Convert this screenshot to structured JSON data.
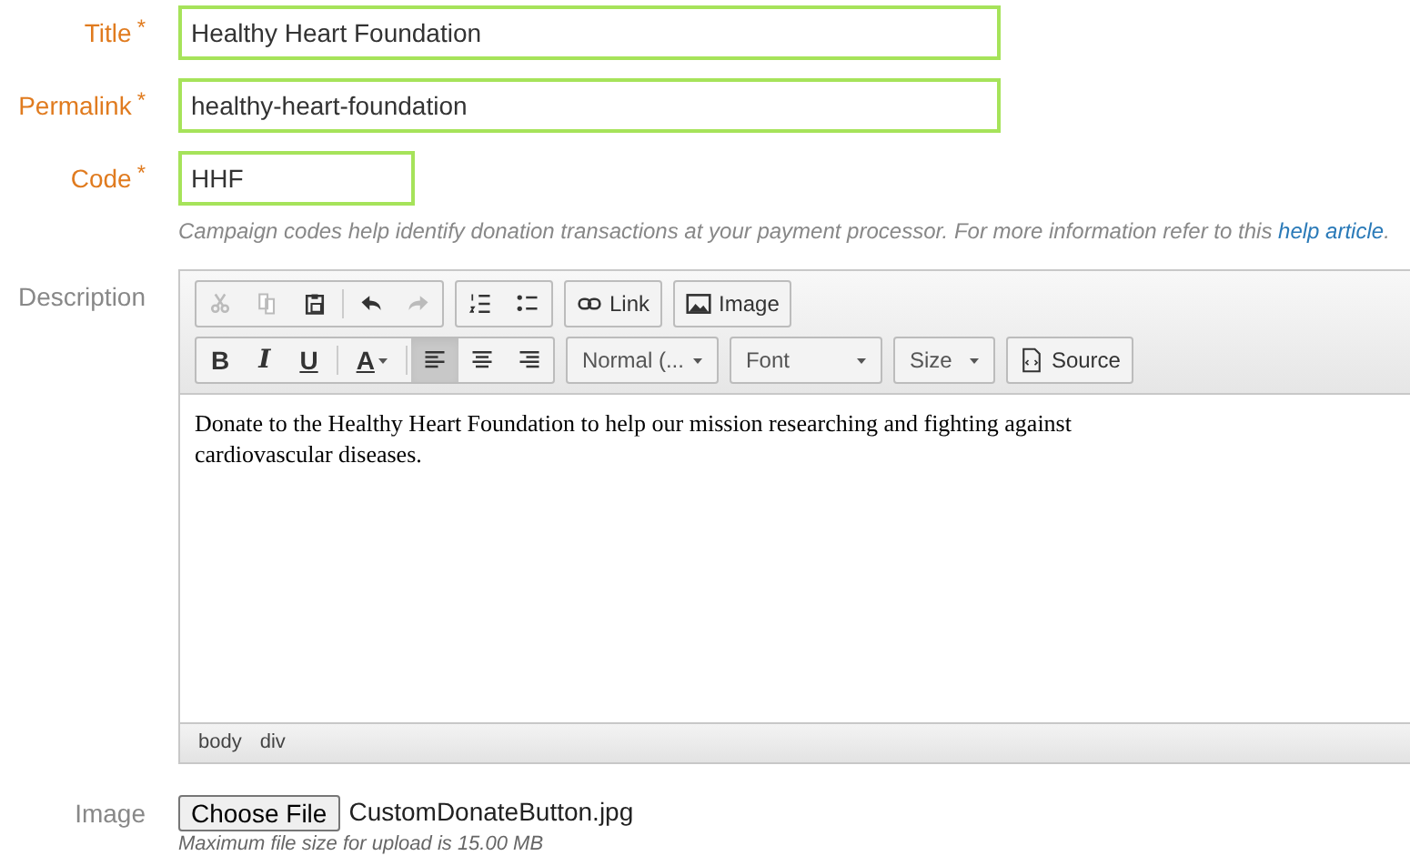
{
  "fields": [
    {
      "label": "Title",
      "marker": "*",
      "value": "Healthy Heart Foundation"
    },
    {
      "label": "Permalink",
      "marker": "*",
      "value": "healthy-heart-foundation"
    },
    {
      "label": "Code",
      "marker": "*",
      "value": "HHF"
    }
  ],
  "code_help": {
    "text": "Campaign codes help identify donation transactions at your payment processor. For more information refer to this",
    "link": "help article",
    "end": "."
  },
  "description": {
    "label": "Description",
    "toolbar_rows": [
      [
        {
          "items": [
            {
              "kind": "icon",
              "disabled": true
            },
            {
              "kind": "icon",
              "disabled": true
            },
            {
              "kind": "icon",
              "disabled": false
            },
            {
              "kind": "separator"
            },
            {
              "kind": "icon",
              "disabled": false
            },
            {
              "kind": "icon",
              "disabled": true
            }
          ]
        },
        {
          "items": [
            {
              "kind": "icon",
              "disabled": false
            },
            {
              "kind": "icon",
              "disabled": false
            }
          ]
        },
        {
          "items": [
            {
              "kind": "icon_text",
              "label": "Link"
            }
          ]
        },
        {
          "items": [
            {
              "kind": "icon_text",
              "label": "Image"
            }
          ]
        }
      ],
      [
        {
          "items": [
            {
              "kind": "char",
              "label": "B"
            },
            {
              "kind": "char",
              "label": "I"
            },
            {
              "kind": "char",
              "label": "U"
            },
            {
              "kind": "separator"
            },
            {
              "kind": "char",
              "label": "A"
            },
            {
              "kind": "separator"
            },
            {
              "kind": "icon",
              "selected": true
            },
            {
              "kind": "icon",
              "selected": false
            },
            {
              "kind": "icon",
              "selected": false
            }
          ]
        },
        {
          "items": [
            {
              "kind": "combo",
              "label": "Normal (..."
            }
          ]
        },
        {
          "items": [
            {
              "kind": "combo",
              "label": "Font"
            }
          ]
        },
        {
          "items": [
            {
              "kind": "combo",
              "label": "Size"
            }
          ]
        },
        {
          "items": [
            {
              "kind": "icon_text",
              "label": "Source"
            }
          ]
        }
      ]
    ],
    "content": "Donate to the Healthy Heart Foundation to help our mission researching and fighting against cardiovascular diseases.",
    "path": [
      "body",
      "div"
    ]
  },
  "image": {
    "label": "Image",
    "button": "Choose File",
    "file": "CustomDonateButton.jpg",
    "hint": "Maximum file size for upload is 15.00 MB"
  }
}
